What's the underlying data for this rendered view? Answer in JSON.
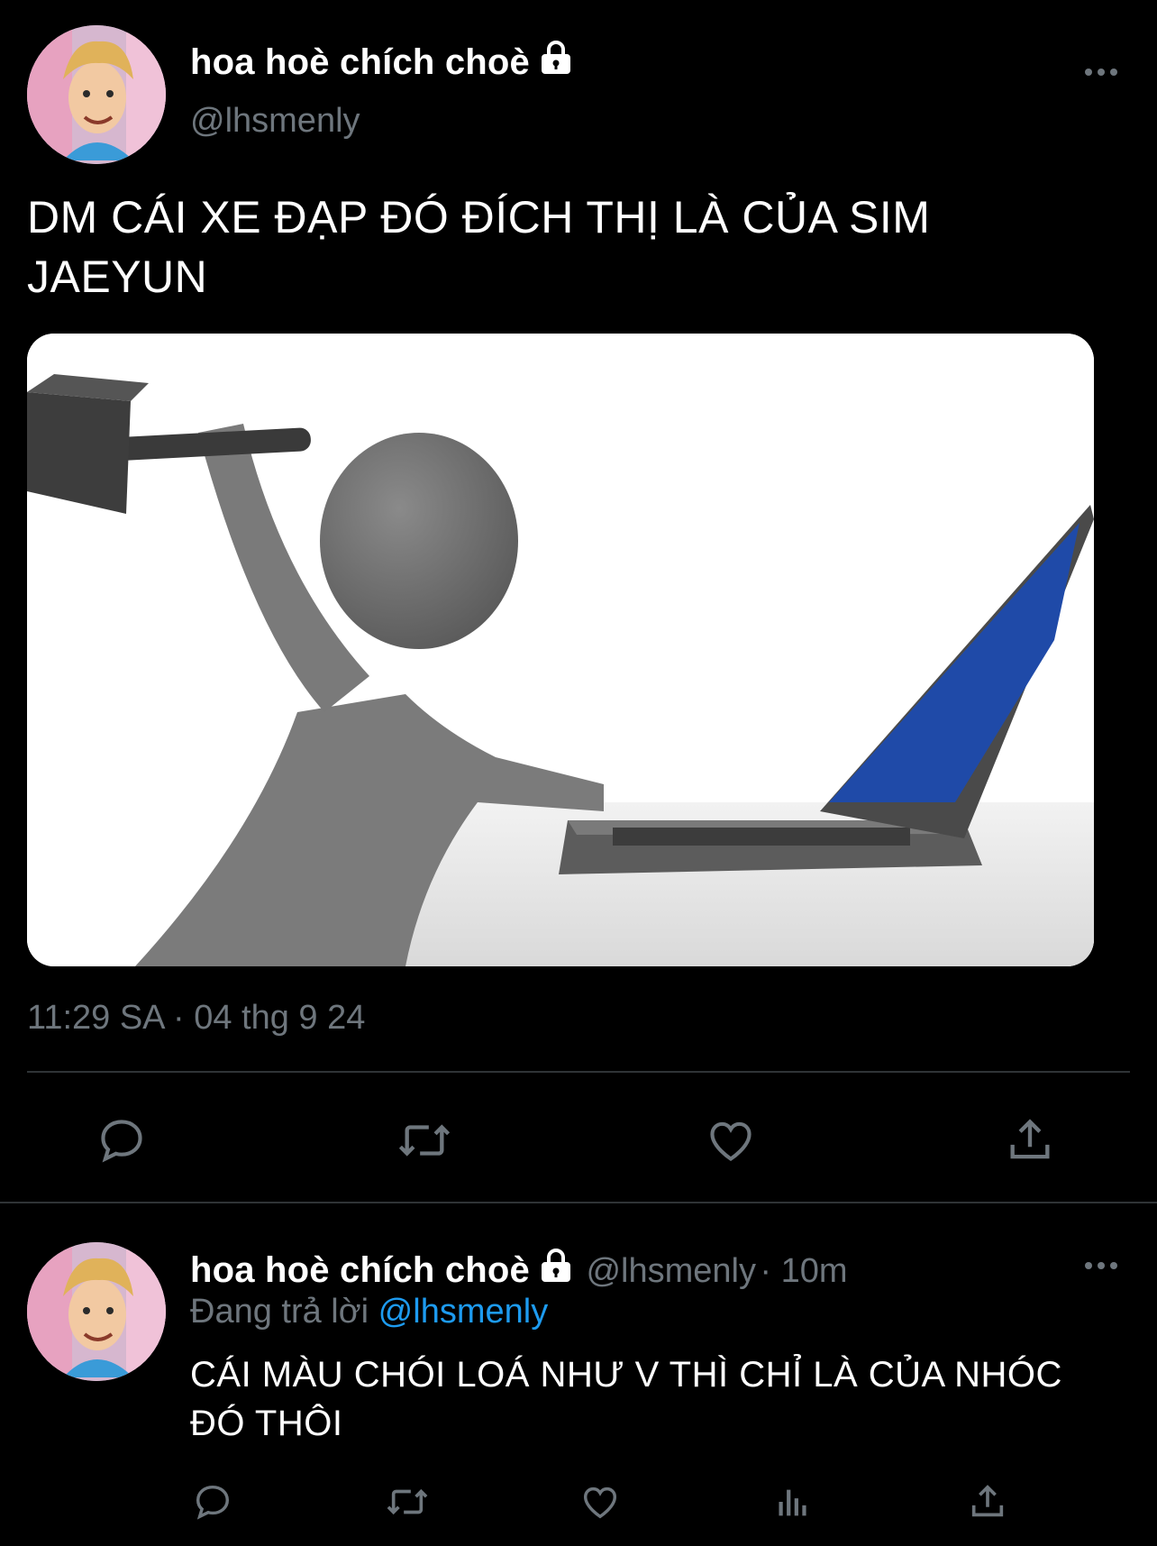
{
  "main_tweet": {
    "display_name": "hoa hoè chích choè",
    "handle": "@lhsmenly",
    "text_line1": "DM CÁI XE ĐẠP ĐÓ ĐÍCH THỊ LÀ CỦA SIM",
    "text_line2": "JAEYUN",
    "timestamp": "11:29 SA · 04 thg 9 24",
    "actions": [
      "reply-icon",
      "retweet-icon",
      "like-icon",
      "share-icon"
    ]
  },
  "reply_tweet": {
    "display_name": "hoa hoè chích choè",
    "handle": "@lhsmenly",
    "age": "· 10m",
    "replying_prefix": "Đang trả lời",
    "replying_to": "@lhsmenly",
    "text_line1": "CÁI MÀU CHÓI LOÁ NHƯ V THÌ CHỈ LÀ CỦA NHÓC",
    "text_line2": "ĐÓ THÔI",
    "actions": [
      "reply-icon",
      "retweet-icon",
      "like-icon",
      "analytics-icon",
      "share-icon"
    ]
  },
  "colors": {
    "background": "#000000",
    "text": "#ffffff",
    "muted": "#6e767d",
    "link": "#1d9bf0",
    "divider": "#2f3336"
  }
}
